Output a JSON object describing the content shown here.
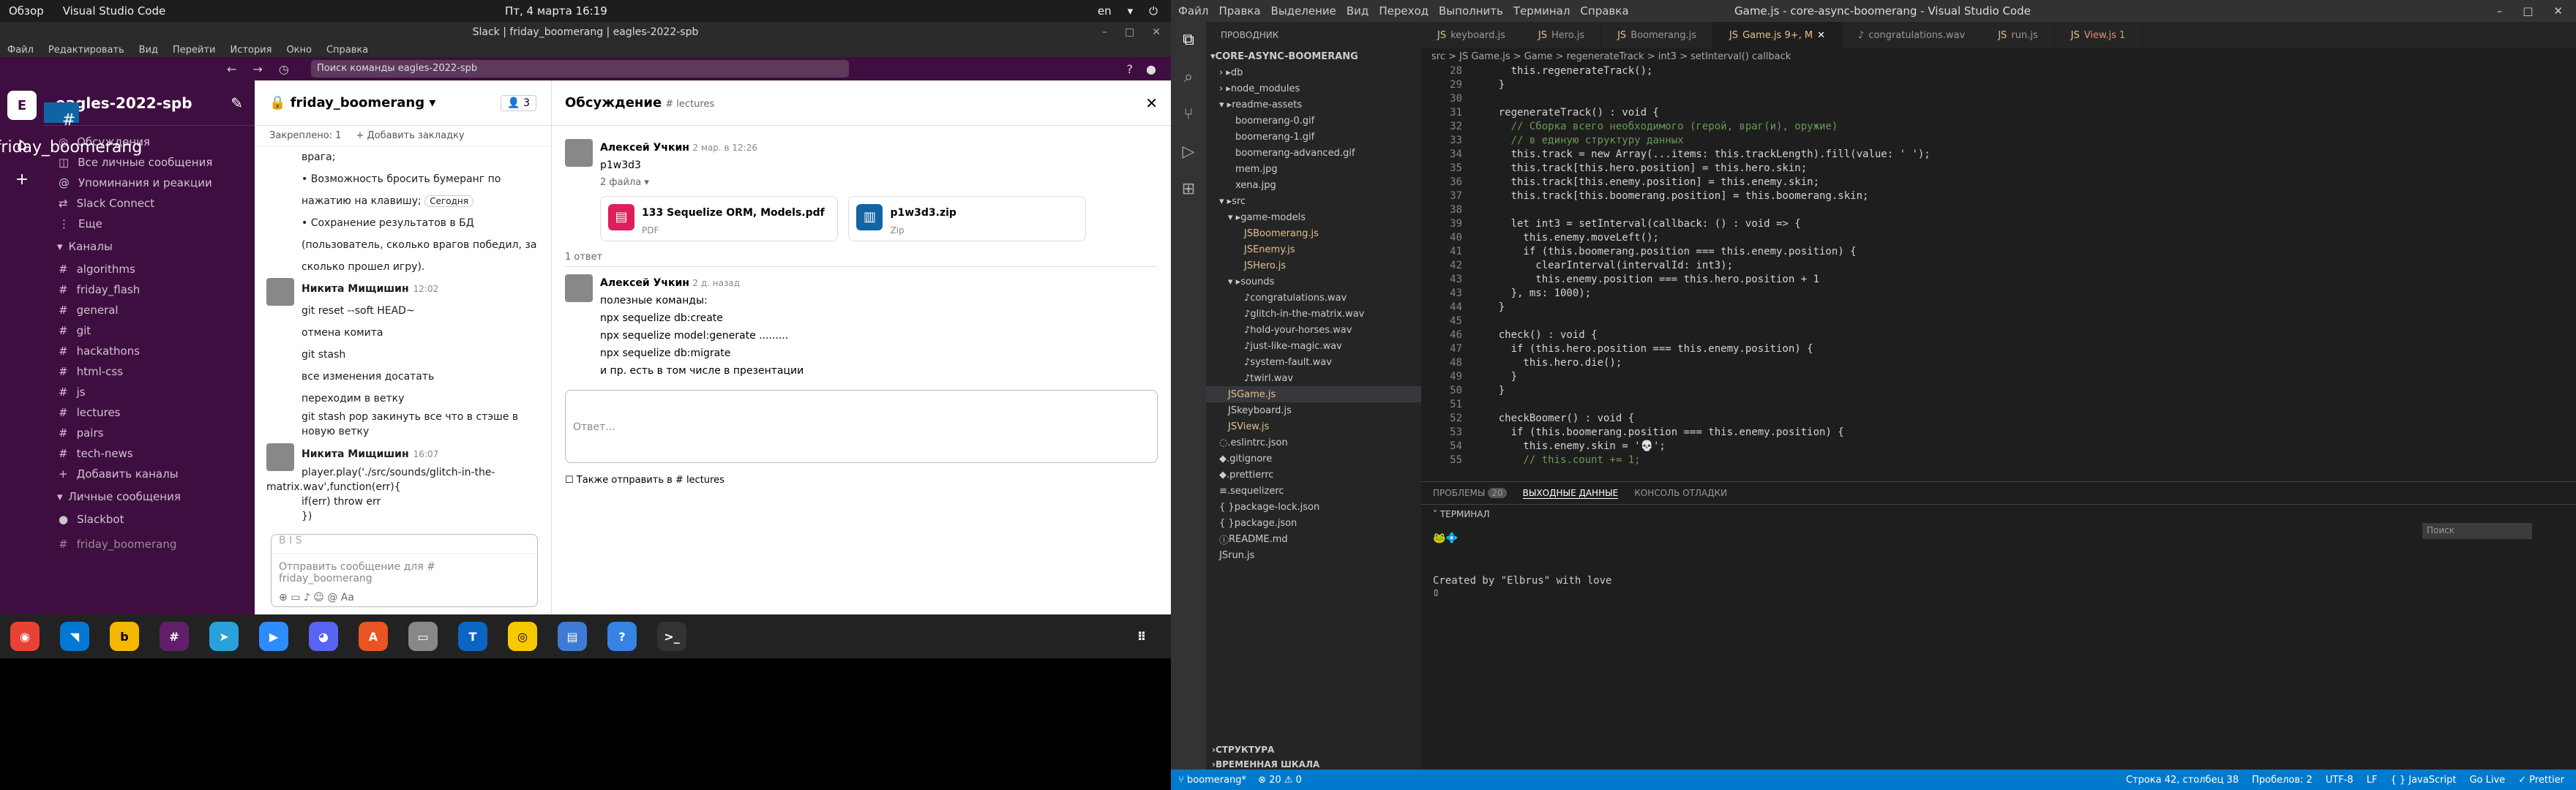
{
  "topbar": {
    "overview": "Обзор",
    "app": "Visual Studio Code",
    "clock": "Пт, 4 марта  16:19",
    "lang": "en"
  },
  "slack": {
    "title": "Slack | friday_boomerang | eagles-2022-spb",
    "menu": [
      "Файл",
      "Редактировать",
      "Вид",
      "Перейти",
      "История",
      "Окно",
      "Справка"
    ],
    "search_placeholder": "Поиск команды eagles-2022-spb",
    "workspace": "eagles-2022-spb",
    "nav": [
      "Обсуждения",
      "Все личные сообщения",
      "Упоминания и реакции",
      "Slack Connect",
      "Еще"
    ],
    "channels_label": "Каналы",
    "channels": [
      "algorithms",
      "friday_boomerang",
      "friday_flash",
      "general",
      "git",
      "hackathons",
      "html-css",
      "js",
      "lectures",
      "pairs",
      "tech-news"
    ],
    "add_channels": "Добавить каналы",
    "dm_label": "Личные сообщения",
    "dm": [
      "Slackbot"
    ],
    "footer_user": "friday_boomerang",
    "channel_header": "friday_boomerang",
    "members": "3",
    "pinned": "Закреплено: 1",
    "bookmark": "+ Добавить закладку",
    "messages": [
      {
        "lines": [
          "врага;",
          "Возможность бросить бумеранг по нажатию на клавишу;",
          "Сохранение результатов в БД (пользователь, сколько врагов победил, за сколько прошел игру)."
        ],
        "badge": "Сегодня"
      },
      {
        "name": "Никита Мищишин",
        "time": "12:02",
        "lines": [
          "git reset --soft HEAD~",
          "отмена комита",
          "git stash",
          "все изменения досатать",
          "переходим в ветку",
          "git stash pop закинуть все что в стэше в новую ветку"
        ]
      },
      {
        "name": "Никита Мищишин",
        "time": "16:07",
        "lines": [
          "player.play('./src/sounds/glitch-in-the-matrix.wav',function(err){",
          "      if(err) throw err",
          "})"
        ]
      }
    ],
    "composer_placeholder": "Отправить сообщение для  # friday_boomerang",
    "thread_title": "Обсуждение",
    "thread_channel": "# lectures",
    "thread": {
      "author": "Алексей Учкин",
      "date": "2 мар. в 12:26",
      "text": "p1w3d3",
      "files_label": "2 файла",
      "files": [
        {
          "name": "133 Sequelize ORM, Models.pdf",
          "type": "PDF"
        },
        {
          "name": "p1w3d3.zip",
          "type": "Zip"
        }
      ],
      "replies": "1 ответ",
      "reply": {
        "author": "Алексей Учкин",
        "date": "2 д. назад",
        "lines": [
          "полезные команды:",
          "npx sequelize db:create",
          "npx sequelize model:generate .........",
          "npx sequelize db:migrate",
          "и пр. есть в том числе в презентации"
        ]
      },
      "reply_placeholder": "Ответ...",
      "also_send": "Также отправить в # lectures"
    }
  },
  "vscode": {
    "menu": [
      "Файл",
      "Правка",
      "Выделение",
      "Вид",
      "Переход",
      "Выполнить",
      "Терминал",
      "Справка"
    ],
    "title": "Game.js - core-async-boomerang - Visual Studio Code",
    "explorer_title": "ПРОВОДНИК",
    "project": "CORE-ASYNC-BOOMERANG",
    "tree": [
      "db",
      "node_modules",
      "readme-assets",
      "boomerang-0.gif",
      "boomerang-1.gif",
      "boomerang-advanced.gif",
      "mem.jpg",
      "xena.jpg",
      "src",
      "game-models",
      "Boomerang.js",
      "Enemy.js",
      "Hero.js",
      "sounds",
      "congratulations.wav",
      "glitch-in-the-matrix.wav",
      "hold-your-horses.wav",
      "just-like-magic.wav",
      "system-fault.wav",
      "twirl.wav",
      "Game.js",
      "keyboard.js",
      "View.js",
      ".eslintrc.json",
      ".gitignore",
      ".prettierrc",
      ".sequelizerc",
      "package-lock.json",
      "package.json",
      "README.md",
      "run.js"
    ],
    "outline": "СТРУКТУРА",
    "timeline": "ВРЕМЕННАЯ ШКАЛА",
    "tabs": [
      "keyboard.js",
      "Hero.js",
      "Boomerang.js",
      "Game.js 9+, M",
      "congratulations.wav",
      "run.js",
      "View.js 1"
    ],
    "breadcrumb": "src > JS Game.js > Game > regenerateTrack > int3 > setInterval() callback",
    "lines": [
      {
        "n": "28",
        "t": "      this.regenerateTrack();"
      },
      {
        "n": "29",
        "t": "    }"
      },
      {
        "n": "30",
        "t": ""
      },
      {
        "n": "31",
        "t": "    regenerateTrack() : void {"
      },
      {
        "n": "32",
        "t": "      // Сборка всего необходимого (герой, враг(и), оружие)"
      },
      {
        "n": "33",
        "t": "      // в единую структуру данных"
      },
      {
        "n": "34",
        "t": "      this.track = new Array(...items: this.trackLength).fill(value: ' ');"
      },
      {
        "n": "35",
        "t": "      this.track[this.hero.position] = this.hero.skin;"
      },
      {
        "n": "36",
        "t": "      this.track[this.enemy.position] = this.enemy.skin;"
      },
      {
        "n": "37",
        "t": "      this.track[this.boomerang.position] = this.boomerang.skin;"
      },
      {
        "n": "38",
        "t": ""
      },
      {
        "n": "39",
        "t": "      let int3 = setInterval(callback: () : void => {"
      },
      {
        "n": "40",
        "t": "        this.enemy.moveLeft();"
      },
      {
        "n": "41",
        "t": "        if (this.boomerang.position === this.enemy.position) {"
      },
      {
        "n": "42",
        "t": "          clearInterval(intervalId: int3);"
      },
      {
        "n": "43",
        "t": "          this.enemy.position === this.hero.position + 1"
      },
      {
        "n": "43",
        "t": "      }, ms: 1000);"
      },
      {
        "n": "44",
        "t": "    }"
      },
      {
        "n": "45",
        "t": ""
      },
      {
        "n": "46",
        "t": "    check() : void {"
      },
      {
        "n": "47",
        "t": "      if (this.hero.position === this.enemy.position) {"
      },
      {
        "n": "48",
        "t": "        this.hero.die();"
      },
      {
        "n": "49",
        "t": "      }"
      },
      {
        "n": "50",
        "t": "    }"
      },
      {
        "n": "51",
        "t": ""
      },
      {
        "n": "52",
        "t": "    checkBoomer() : void {"
      },
      {
        "n": "53",
        "t": "      if (this.boomerang.position === this.enemy.position) {"
      },
      {
        "n": "54",
        "t": "        this.enemy.skin = '💀';"
      },
      {
        "n": "55",
        "t": "        // this.count += 1;"
      }
    ],
    "panel_tabs": [
      "ПРОБЛЕМЫ",
      "ВЫХОДНЫЕ ДАННЫЕ",
      "КОНСОЛЬ ОТЛАДКИ"
    ],
    "problems_count": "20",
    "terminal_label": "ТЕРМИНАЛ",
    "terminal_search": "Поиск",
    "terminal_text": "Created by \"Elbrus\" with love",
    "status": {
      "branch": "boomerang*",
      "errors": "⊗ 20 ⚠ 0",
      "cursor": "Строка 42, столбец 38",
      "spaces": "Пробелов: 2",
      "enc": "UTF-8",
      "eol": "LF",
      "lang": "{ } JavaScript",
      "live": "Go Live",
      "prettier": "✓ Prettier"
    }
  }
}
